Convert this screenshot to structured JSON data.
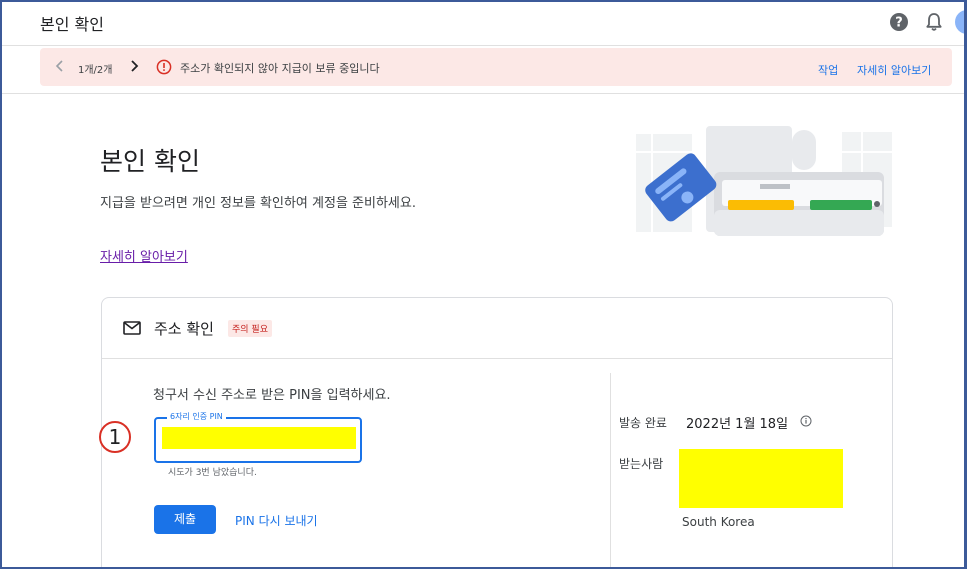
{
  "header": {
    "title": "본인 확인",
    "help_icon": "help-circle-icon",
    "notifications_icon": "bell-icon"
  },
  "alert": {
    "pager": "1개/2개",
    "message": "주소가 확인되지 않아 지급이 보류 중입니다",
    "action_label": "작업",
    "learn_more_label": "자세히 알아보기",
    "background_color": "#fce8e6",
    "icon_color": "#d93025"
  },
  "intro": {
    "title": "본인 확인",
    "description": "지급을 받으려면 개인 정보를 확인하여 계정을 준비하세요.",
    "learn_more_label": "자세히 알아보기"
  },
  "address_card": {
    "title": "주소 확인",
    "badge": "주의 필요",
    "instruction": "청구서 수신 주소로 받은 PIN을 입력하세요.",
    "step_marker": "1",
    "pin_field": {
      "label": "6자리 인증 PIN",
      "value": ""
    },
    "attempts_text": "시도가 3번 남았습니다.",
    "submit_label": "제출",
    "resend_label": "PIN 다시 보내기",
    "sent_label": "발송 완료",
    "sent_date": "2022년 1월 18일",
    "recipient_label": "받는사람",
    "country": "South Korea"
  },
  "colors": {
    "accent": "#1a73e8",
    "link_visited": "#681da8",
    "warning_text": "#c5221f",
    "redaction": "#ffff00"
  }
}
